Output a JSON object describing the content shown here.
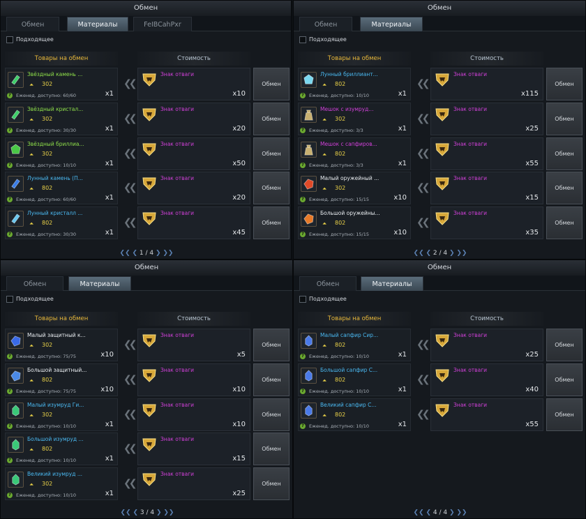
{
  "panels": [
    {
      "title": "Обмен",
      "tabs": [
        "Обмен",
        "Материалы",
        "FeIBCahPxr"
      ],
      "active_tab": 1,
      "filter_label": "Подходящее",
      "goods_header": "Товары на обмен",
      "cost_header": "Стоимость",
      "exchange_label": "Обмен",
      "pager": "1 / 4",
      "rows": [
        {
          "name": "Звёздный камень ...",
          "name_color": "#8fe04a",
          "level": "302",
          "weekly": "Еженед. доступно: 60/60",
          "count": "x1",
          "cost_name": "Знак отваги",
          "cost_count": "x10",
          "icon": "green-crystal-icon",
          "icon_color": "#3fd06a"
        },
        {
          "name": "Звёздный кристал...",
          "name_color": "#8fe04a",
          "level": "302",
          "weekly": "Еженед. доступно: 30/30",
          "count": "x1",
          "cost_name": "Знак отваги",
          "cost_count": "x20",
          "icon": "green-crystal-icon",
          "icon_color": "#3fd06a"
        },
        {
          "name": "Звёздный бриллиа...",
          "name_color": "#8fe04a",
          "level": "302",
          "weekly": "Еженед. доступно: 10/10",
          "count": "x1",
          "cost_name": "Знак отваги",
          "cost_count": "x50",
          "icon": "green-gem-icon",
          "icon_color": "#4ac846"
        },
        {
          "name": "Лунный камень (П...",
          "name_color": "#4ab8f0",
          "level": "802",
          "weekly": "Еженед. доступно: 60/60",
          "count": "x1",
          "cost_name": "Знак отваги",
          "cost_count": "x20",
          "icon": "blue-crystal-icon",
          "icon_color": "#3a7de8"
        },
        {
          "name": "Лунный кристалл ...",
          "name_color": "#4ab8f0",
          "level": "802",
          "weekly": "Еженед. доступно: 30/30",
          "count": "x1",
          "cost_name": "Знак отваги",
          "cost_count": "x45",
          "icon": "blue-crystal-icon",
          "icon_color": "#6ac8f0"
        }
      ]
    },
    {
      "title": "Обмен",
      "tabs": [
        "Обмен",
        "Материалы"
      ],
      "active_tab": 1,
      "filter_label": "Подходящее",
      "goods_header": "Товары на обмен",
      "cost_header": "Стоимость",
      "exchange_label": "Обмен",
      "pager": "2 / 4",
      "rows": [
        {
          "name": "Лунный бриллиант...",
          "name_color": "#4ab8f0",
          "level": "802",
          "weekly": "Еженед. доступно: 10/10",
          "count": "x1",
          "cost_name": "Знак отваги",
          "cost_count": "x115",
          "icon": "blue-gem-icon",
          "icon_color": "#7ad8f0"
        },
        {
          "name": "Мешок с изумруд...",
          "name_color": "#d040d8",
          "level": "302",
          "weekly": "Еженед. доступно: 3/3",
          "count": "x1",
          "cost_name": "Знак отваги",
          "cost_count": "x25",
          "icon": "bag-icon",
          "icon_color": "#c8b070"
        },
        {
          "name": "Мешок с сапфиров...",
          "name_color": "#d040d8",
          "level": "802",
          "weekly": "Еженед. доступно: 3/3",
          "count": "x1",
          "cost_name": "Знак отваги",
          "cost_count": "x55",
          "icon": "bag-icon",
          "icon_color": "#c8b070"
        },
        {
          "name": "Малый оружейный ...",
          "name_color": "#e8ecf0",
          "level": "302",
          "weekly": "Еженед. доступно: 15/15",
          "count": "x10",
          "cost_name": "Знак отваги",
          "cost_count": "x15",
          "icon": "red-stone-icon",
          "icon_color": "#e04a28"
        },
        {
          "name": "Большой оружейны...",
          "name_color": "#e8ecf0",
          "level": "802",
          "weekly": "Еженед. доступно: 15/15",
          "count": "x10",
          "cost_name": "Знак отваги",
          "cost_count": "x35",
          "icon": "orange-stone-icon",
          "icon_color": "#e87a28"
        }
      ]
    },
    {
      "title": "Обмен",
      "tabs": [
        "Обмен",
        "Материалы"
      ],
      "active_tab": 1,
      "filter_label": "Подходящее",
      "goods_header": "Товары на обмен",
      "cost_header": "Стоимость",
      "exchange_label": "Обмен",
      "pager": "3 / 4",
      "rows": [
        {
          "name": "Малый защитный к...",
          "name_color": "#e8ecf0",
          "level": "302",
          "weekly": "Еженед. доступно: 75/75",
          "count": "x10",
          "cost_name": "Знак отваги",
          "cost_count": "x5",
          "icon": "blue-stone-icon",
          "icon_color": "#3a6ae8"
        },
        {
          "name": "Большой защитный...",
          "name_color": "#e8ecf0",
          "level": "802",
          "weekly": "Еженед. доступно: 75/75",
          "count": "x10",
          "cost_name": "Знак отваги",
          "cost_count": "x10",
          "icon": "blue-stone-icon",
          "icon_color": "#4a8ae8"
        },
        {
          "name": "Малый изумруд Ги...",
          "name_color": "#4ab8f0",
          "level": "302",
          "weekly": "Еженед. доступно: 10/10",
          "count": "x1",
          "cost_name": "Знак отваги",
          "cost_count": "x10",
          "icon": "emerald-icon",
          "icon_color": "#3ac878"
        },
        {
          "name": "Большой изумруд ...",
          "name_color": "#4ab8f0",
          "level": "802",
          "weekly": "Еженед. доступно: 10/10",
          "count": "x1",
          "cost_name": "Знак отваги",
          "cost_count": "x15",
          "icon": "emerald-icon",
          "icon_color": "#3ac878"
        },
        {
          "name": "Великий изумруд ...",
          "name_color": "#4ab8f0",
          "level": "302",
          "weekly": "Еженед. доступно: 10/10",
          "count": "x1",
          "cost_name": "Знак отваги",
          "cost_count": "x25",
          "icon": "emerald-icon",
          "icon_color": "#3ac878"
        }
      ]
    },
    {
      "title": "Обмен",
      "tabs": [
        "Обмен",
        "Материалы"
      ],
      "active_tab": 1,
      "filter_label": "Подходящее",
      "goods_header": "Товары на обмен",
      "cost_header": "Стоимость",
      "exchange_label": "Обмен",
      "pager": "4 / 4",
      "rows": [
        {
          "name": "Малый сапфир Сир...",
          "name_color": "#4ab8f0",
          "level": "802",
          "weekly": "Еженед. доступно: 10/10",
          "count": "x1",
          "cost_name": "Знак отваги",
          "cost_count": "x25",
          "icon": "sapphire-icon",
          "icon_color": "#4a7ae8"
        },
        {
          "name": "Большой сапфир С...",
          "name_color": "#4ab8f0",
          "level": "802",
          "weekly": "Еженед. доступно: 10/10",
          "count": "x1",
          "cost_name": "Знак отваги",
          "cost_count": "x40",
          "icon": "sapphire-icon",
          "icon_color": "#4a7ae8"
        },
        {
          "name": "Великий сапфир С...",
          "name_color": "#4ab8f0",
          "level": "802",
          "weekly": "Еженед. доступно: 10/10",
          "count": "x1",
          "cost_name": "Знак отваги",
          "cost_count": "x55",
          "icon": "sapphire-icon",
          "icon_color": "#4a7ae8"
        }
      ]
    }
  ],
  "colors": {
    "accent_gold": "#e8b83a",
    "cost_name": "#d040d8",
    "level": "#e8d048"
  }
}
